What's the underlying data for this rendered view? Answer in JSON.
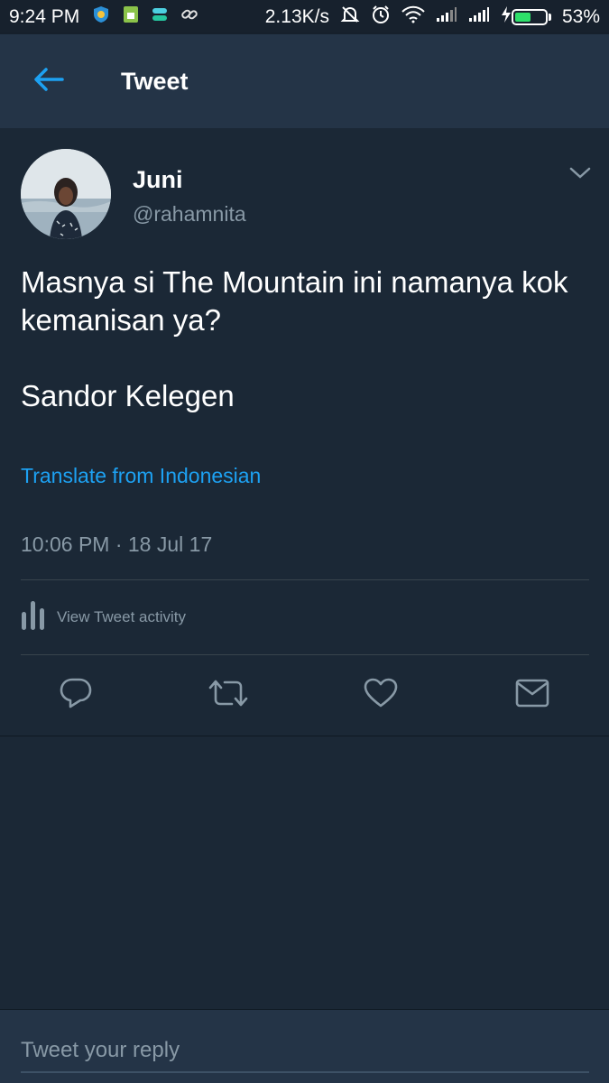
{
  "status_bar": {
    "time": "9:24 PM",
    "network_speed": "2.13K/s",
    "battery_percent": "53%",
    "battery_level": 0.53,
    "icons": [
      "shield-app-icon",
      "sim-icon",
      "app-icon",
      "link-icon",
      "muted-bell-icon",
      "alarm-icon",
      "wifi-icon",
      "signal-icon",
      "signal-icon",
      "charging-icon"
    ],
    "battery_color": "#2ee06a"
  },
  "header": {
    "title": "Tweet",
    "back_icon": "arrow-left-icon",
    "accent_color": "#1da1f2"
  },
  "tweet": {
    "author_name": "Juni",
    "author_handle": "@rahamnita",
    "text_line1": "Masnya si The Mountain ini namanya kok kemanisan ya?",
    "text_line2": "Sandor Kelegen",
    "translate_label": "Translate from Indonesian",
    "timestamp": "10:06 PM · 18 Jul 17",
    "activity_label": "View Tweet activity"
  },
  "actions": {
    "icons": [
      "reply-icon",
      "retweet-icon",
      "like-icon",
      "direct-message-icon"
    ]
  },
  "reply": {
    "placeholder": "Tweet your reply"
  }
}
